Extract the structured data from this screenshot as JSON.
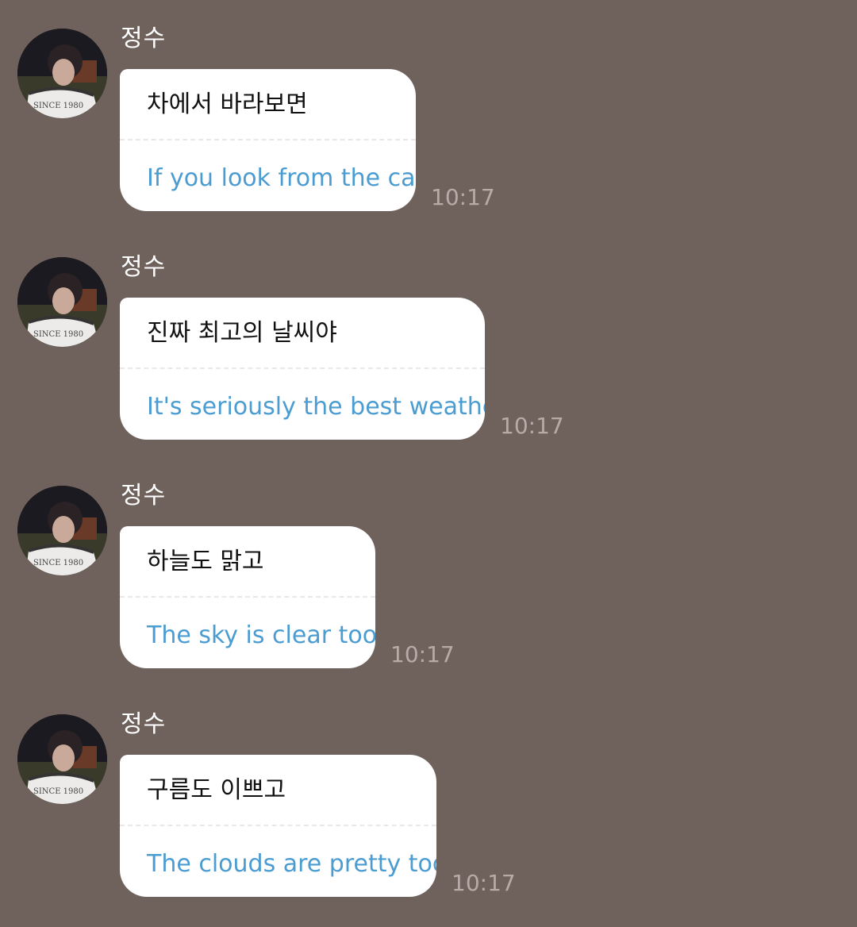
{
  "messages": [
    {
      "sender": "정수",
      "original": "차에서 바라보면",
      "translation": "If you look from the car",
      "time": "10:17",
      "avatar_icon": "profile-photo"
    },
    {
      "sender": "정수",
      "original": "진짜 최고의 날씨야",
      "translation": "It's seriously the best weather",
      "time": "10:17",
      "avatar_icon": "profile-photo"
    },
    {
      "sender": "정수",
      "original": "하늘도 맑고",
      "translation": "The sky is clear too",
      "time": "10:17",
      "avatar_icon": "profile-photo"
    },
    {
      "sender": "정수",
      "original": "구름도 이쁘고",
      "translation": "The clouds are pretty too",
      "time": "10:17",
      "avatar_icon": "profile-photo"
    }
  ],
  "avatar_shirt_text": "SINCE 1980",
  "colors": {
    "background": "#6f625d",
    "bubble": "#ffffff",
    "original_text": "#111111",
    "translation_text": "#4b9cd1",
    "timestamp": "#b6aba6",
    "sender": "#ffffff"
  }
}
